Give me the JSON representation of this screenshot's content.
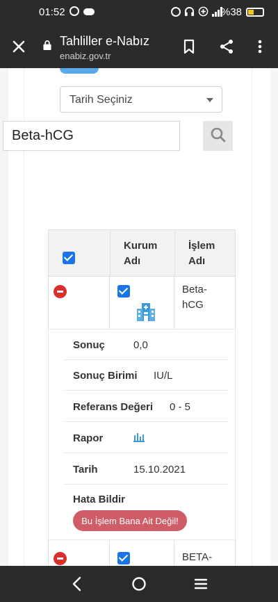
{
  "status_bar": {
    "time": "01:52",
    "battery": "%38"
  },
  "app_bar": {
    "title": "Tahliller e-Nabız",
    "url": "enabiz.gov.tr"
  },
  "filters": {
    "date_select": "Tarih Seçiniz",
    "search_value": "Beta-hCG"
  },
  "table": {
    "headers": {
      "institution": "Kurum Adı",
      "operation": "İşlem Adı"
    },
    "rows": [
      {
        "operation": "Beta-hCG",
        "details": {
          "result_label": "Sonuç",
          "result_value": "0,0",
          "unit_label": "Sonuç Birimi",
          "unit_value": "IU/L",
          "ref_label": "Referans Değeri",
          "ref_value": "0 - 5",
          "report_label": "Rapor",
          "date_label": "Tarih",
          "date_value": "15.10.2021",
          "error_label": "Hata Bildir",
          "error_button": "Bu İşlem Bana Ait Değil!"
        }
      },
      {
        "operation": "BETA-"
      }
    ]
  },
  "icons": {
    "close": "close-icon",
    "lock": "lock-icon",
    "bookmark": "bookmark-icon",
    "share": "share-icon",
    "more": "more-vert-icon",
    "search": "search-icon",
    "hospital": "hospital-icon",
    "report": "bar-chart-icon"
  },
  "colors": {
    "accent": "#1a73e8",
    "danger": "#d9302c",
    "error_button": "#cf5c66",
    "bar": "#2a2b2d"
  }
}
